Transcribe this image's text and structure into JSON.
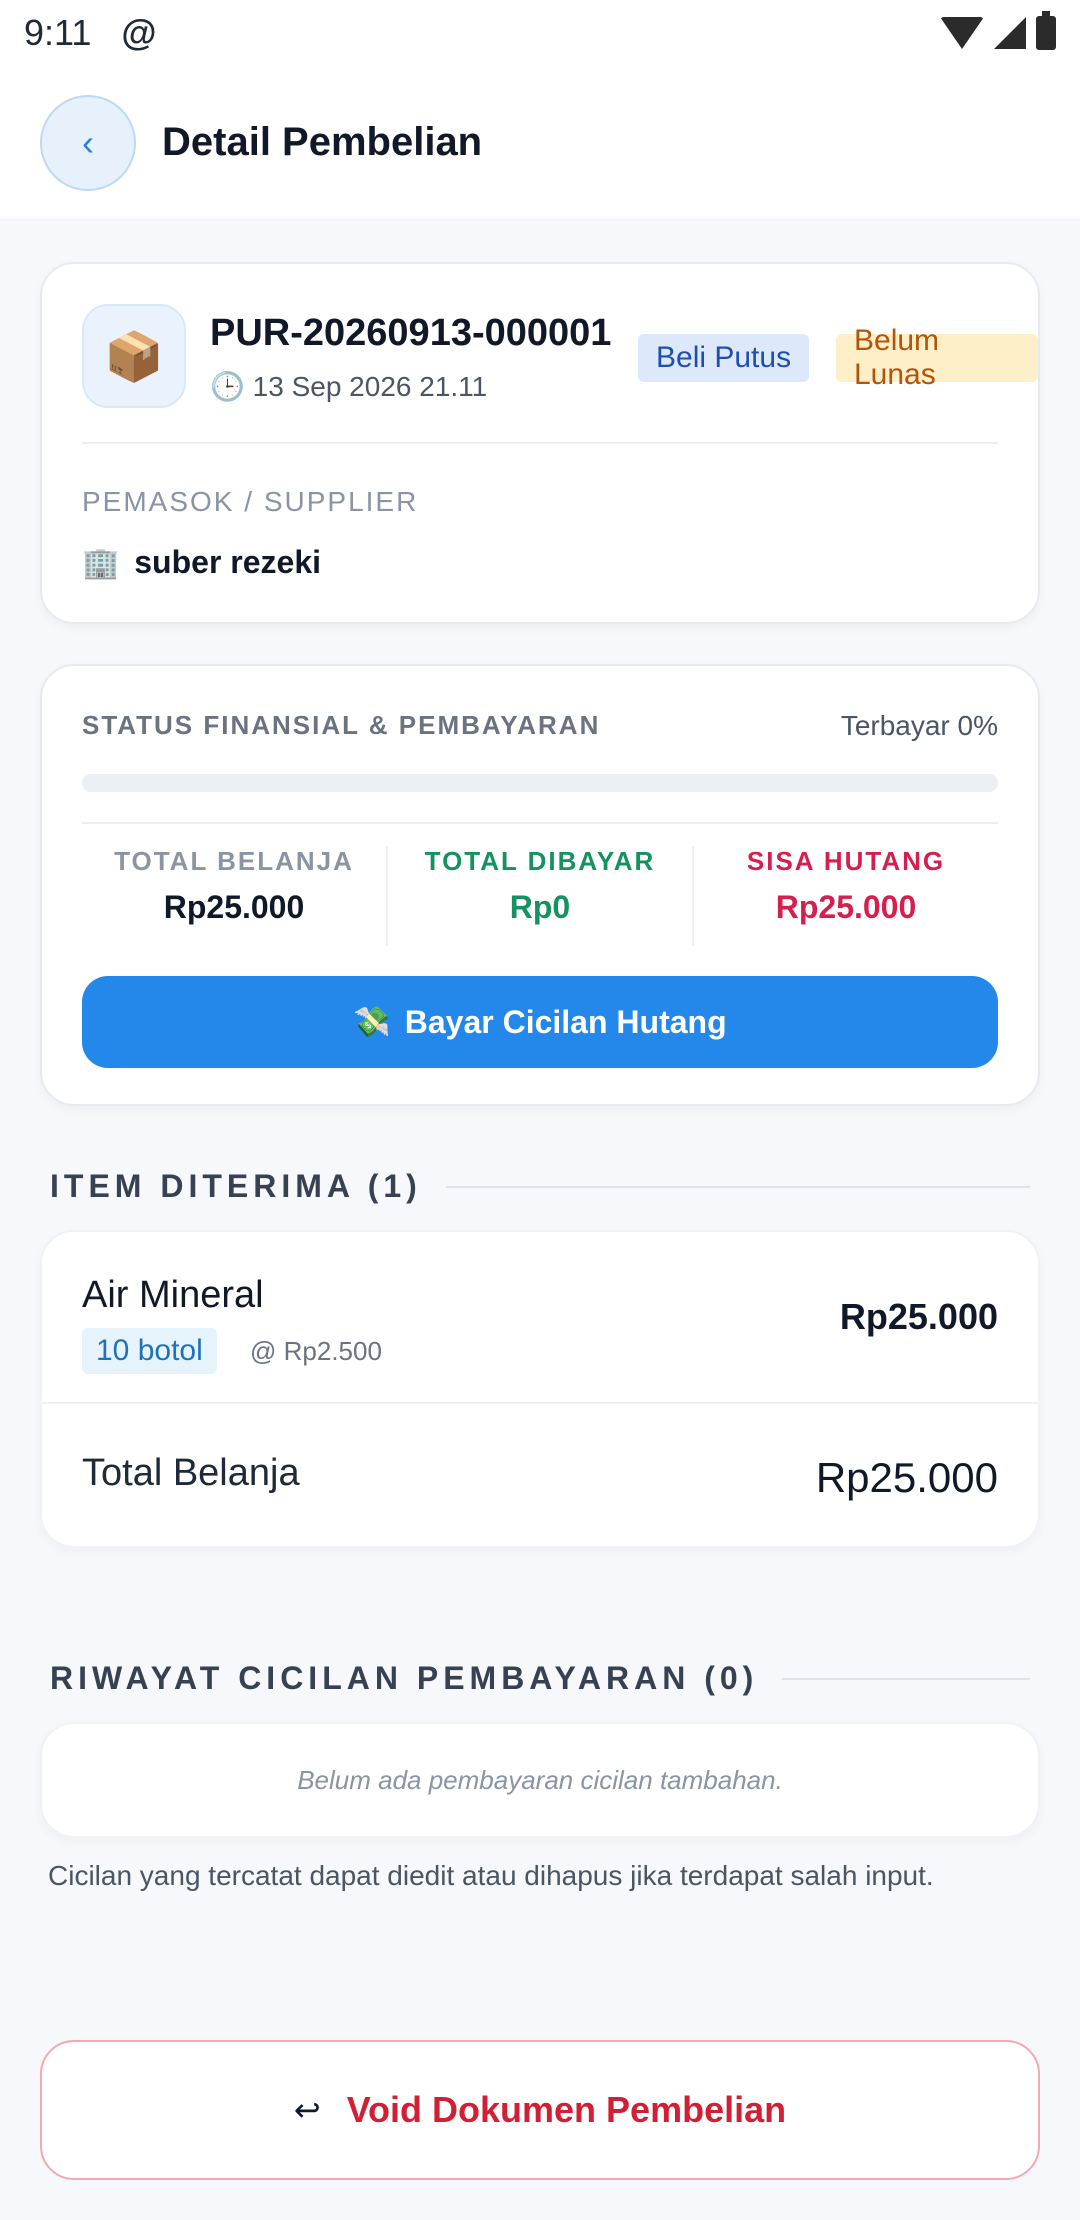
{
  "status_bar": {
    "time": "9:11",
    "at_icon": "@"
  },
  "header": {
    "back_label": "‹",
    "title": "Detail Pembelian"
  },
  "purchase": {
    "icon": "📦",
    "number": "PUR-20260913-000001",
    "date_icon": "🕒",
    "date": "13 Sep 2026 21.11",
    "badge_type": "Beli Putus",
    "badge_status": "Belum Lunas",
    "supplier_label": "PEMASOK / SUPPLIER",
    "supplier_icon": "🏢",
    "supplier_name": "suber rezeki"
  },
  "finance": {
    "title": "STATUS FINANSIAL & PEMBAYARAN",
    "paid_percent_text": "Terbayar 0%",
    "paid_fraction": 0,
    "total_label": "TOTAL BELANJA",
    "total_value": "Rp25.000",
    "paid_label": "TOTAL DIBAYAR",
    "paid_value": "Rp0",
    "debt_label": "SISA HUTANG",
    "debt_value": "Rp25.000",
    "pay_button_icon": "💸",
    "pay_button_label": "Bayar Cicilan Hutang"
  },
  "items_section": {
    "title": "ITEM DITERIMA (1)",
    "items": [
      {
        "name": "Air Mineral",
        "qty": "10 botol",
        "unit_price": "@ Rp2.500",
        "total": "Rp25.000"
      }
    ],
    "sum_label": "Total Belanja",
    "sum_value": "Rp25.000"
  },
  "history_section": {
    "title": "RIWAYAT CICILAN PEMBAYARAN (0)",
    "empty_text": "Belum ada pembayaran cicilan tambahan.",
    "note": "Cicilan yang tercatat dapat diedit atau dihapus jika terdapat salah input."
  },
  "void_button": {
    "icon": "↩",
    "label": "Void Dokumen Pembelian"
  },
  "colors": {
    "primary": "#2388ea",
    "success": "#14925f",
    "danger": "#d61f4f",
    "warning_bg": "#fdf0c8"
  }
}
